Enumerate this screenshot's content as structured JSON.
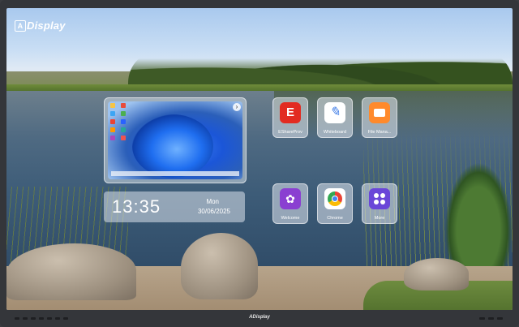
{
  "brand": {
    "logo_text": "Display",
    "badge": "A"
  },
  "desktop_preview": {
    "arrow_glyph": "›"
  },
  "clock": {
    "time": "13:35",
    "day": "Mon",
    "date": "30/06/2025"
  },
  "apps": [
    {
      "label": "EShareProv",
      "icon": "eshare-icon"
    },
    {
      "label": "Whiteboard",
      "icon": "whiteboard-icon"
    },
    {
      "label": "File Mana...",
      "icon": "file-manager-icon"
    },
    {
      "label": "Welcome",
      "icon": "welcome-icon"
    },
    {
      "label": "Chrome",
      "icon": "chrome-icon"
    },
    {
      "label": "More",
      "icon": "more-apps-icon"
    }
  ],
  "bezel": {
    "logo_text": "ADisplay"
  }
}
